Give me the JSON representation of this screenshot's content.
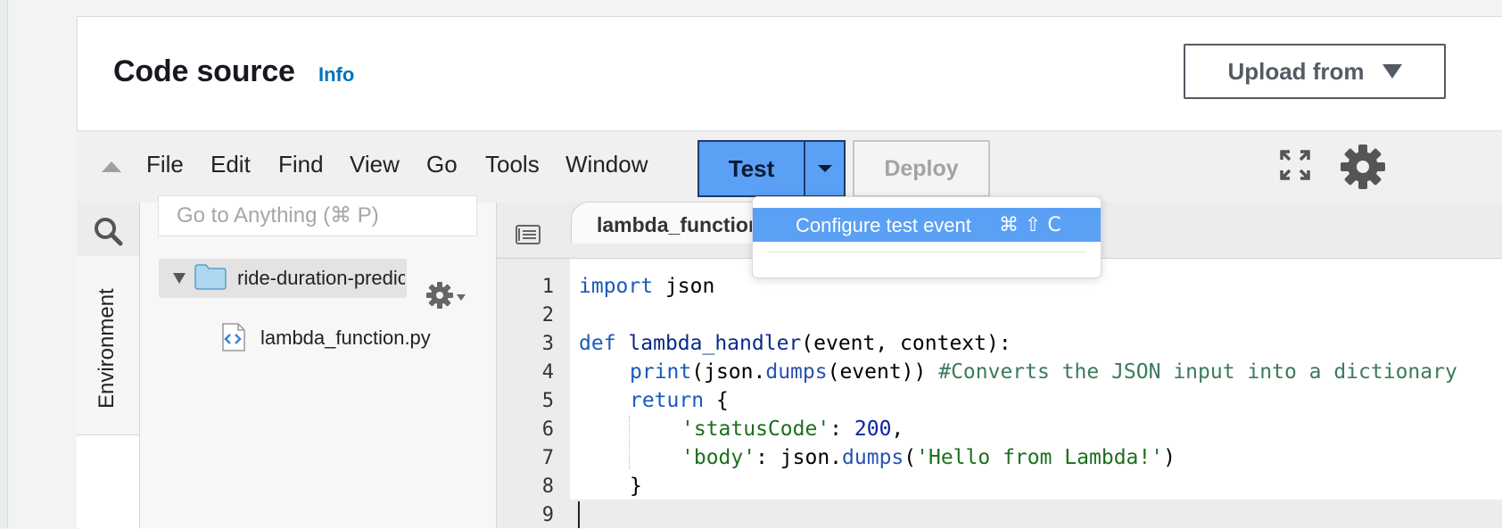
{
  "header": {
    "title": "Code source",
    "info_link": "Info",
    "upload_button": "Upload from"
  },
  "toolbar": {
    "menu": [
      "File",
      "Edit",
      "Find",
      "View",
      "Go",
      "Tools",
      "Window"
    ],
    "test_button": "Test",
    "deploy_button": "Deploy"
  },
  "dropdown": {
    "items": [
      {
        "label": "Configure test event",
        "shortcut": "⌘ ⇧ C"
      }
    ]
  },
  "sidebar": {
    "environment_tab": "Environment",
    "search_placeholder": "Go to Anything (⌘ P)"
  },
  "file_tree": {
    "root_folder": "ride-duration-prediction",
    "files": [
      "lambda_function.py"
    ]
  },
  "editor": {
    "active_tab": "lambda_function.py",
    "line_numbers": [
      "1",
      "2",
      "3",
      "4",
      "5",
      "6",
      "7",
      "8",
      "9"
    ],
    "code": {
      "l1_kw": "import",
      "l1_rest": " json",
      "l3_kw": "def",
      "l3_fn": "lambda_handler",
      "l3_rest": "(event, context):",
      "l4_kw": "print",
      "l4_a": "(json.",
      "l4_meth": "dumps",
      "l4_b": "(event)) ",
      "l4_cmt": "#Converts the JSON input into a dictionary",
      "l5_kw": "return",
      "l5_rest": " {",
      "l6_str": "'statusCode'",
      "l6_mid": ": ",
      "l6_num": "200",
      "l6_end": ",",
      "l7_str": "'body'",
      "l7_mid": ": json.",
      "l7_meth": "dumps",
      "l7_open": "(",
      "l7_str2": "'Hello from Lambda!'",
      "l7_end": ")",
      "l8": "}"
    }
  },
  "colors": {
    "accent": "#5aa0f5",
    "link": "#0073bb",
    "title": "#16191f"
  }
}
